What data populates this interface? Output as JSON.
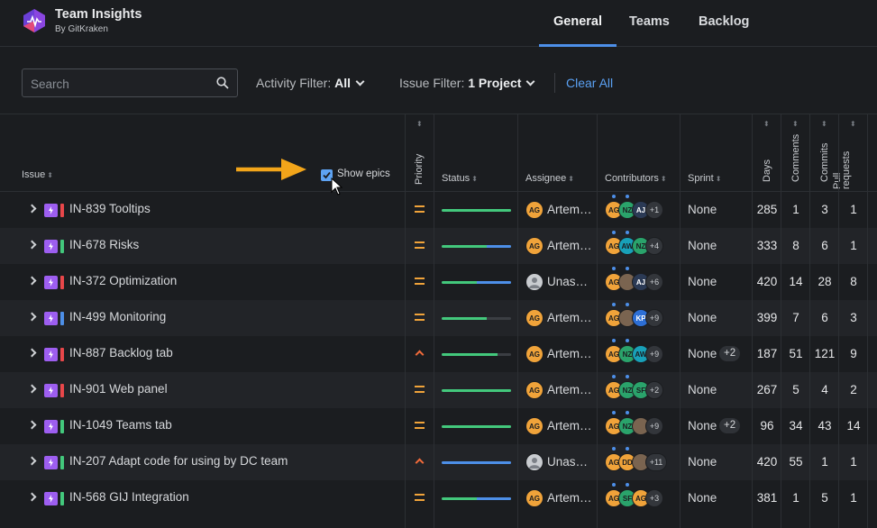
{
  "app": {
    "title": "Team Insights",
    "subtitle": "By GitKraken"
  },
  "nav": {
    "tabs": [
      "General",
      "Teams",
      "Backlog"
    ],
    "active": "General"
  },
  "filters": {
    "search_placeholder": "Search",
    "activity_label": "Activity Filter:",
    "activity_value": "All",
    "issue_label": "Issue Filter:",
    "issue_value": "1 Project",
    "clear_all": "Clear All"
  },
  "columns": {
    "issue": "Issue",
    "show_epics": "Show epics",
    "priority": "Priority",
    "status": "Status",
    "assignee": "Assignee",
    "contributors": "Contributors",
    "sprint": "Sprint",
    "days": "Days",
    "comments": "Comments",
    "commits": "Commits",
    "pull_requests": "Pull requests"
  },
  "colors": {
    "accent": "#4d8fe8",
    "epic": "#9d5ef0",
    "orange": "#f0a33a",
    "green": "#43c87c"
  },
  "rows": [
    {
      "issue": "IN-839 Tooltips",
      "bar_color": "#e8474a",
      "priority": "medium",
      "status_green": 1.0,
      "status_blue": 0.0,
      "assignee": "Artem…",
      "assignee_initials": "AG",
      "assignee_type": "orange",
      "contributors": [
        "AG",
        "NZ",
        "AJ"
      ],
      "contributors_more": "+1",
      "sprint": "None",
      "sprint_more": "",
      "days": "285",
      "comments": "1",
      "commits": "3",
      "prs": "1"
    },
    {
      "issue": "IN-678 Risks",
      "bar_color": "#43c87c",
      "priority": "medium",
      "status_green": 0.65,
      "status_blue": 0.35,
      "assignee": "Artem…",
      "assignee_initials": "AG",
      "assignee_type": "orange",
      "contributors": [
        "AG",
        "AW",
        "NZ"
      ],
      "contributors_more": "+4",
      "sprint": "None",
      "sprint_more": "",
      "days": "333",
      "comments": "8",
      "commits": "6",
      "prs": "1"
    },
    {
      "issue": "IN-372 Optimization",
      "bar_color": "#e8474a",
      "priority": "medium",
      "status_green": 0.5,
      "status_blue": 0.5,
      "assignee": "Unas…",
      "assignee_initials": "",
      "assignee_type": "grey",
      "contributors": [
        "AG",
        "PH",
        "AJ"
      ],
      "contributors_more": "+6",
      "sprint": "None",
      "sprint_more": "",
      "days": "420",
      "comments": "14",
      "commits": "28",
      "prs": "8"
    },
    {
      "issue": "IN-499 Monitoring",
      "bar_color": "#4d8fe8",
      "priority": "medium",
      "status_green": 0.65,
      "status_blue": 0.0,
      "assignee": "Artem…",
      "assignee_initials": "AG",
      "assignee_type": "orange",
      "contributors": [
        "AG",
        "PH",
        "KP"
      ],
      "contributors_more": "+9",
      "sprint": "None",
      "sprint_more": "",
      "days": "399",
      "comments": "7",
      "commits": "6",
      "prs": "3"
    },
    {
      "issue": "IN-887 Backlog tab",
      "bar_color": "#e8474a",
      "priority": "high",
      "status_green": 0.8,
      "status_blue": 0.0,
      "assignee": "Artem…",
      "assignee_initials": "AG",
      "assignee_type": "orange",
      "contributors": [
        "AG",
        "NZ",
        "AW"
      ],
      "contributors_more": "+9",
      "sprint": "None",
      "sprint_more": "+2",
      "days": "187",
      "comments": "51",
      "commits": "121",
      "prs": "9"
    },
    {
      "issue": "IN-901 Web panel",
      "bar_color": "#e8474a",
      "priority": "medium",
      "status_green": 1.0,
      "status_blue": 0.0,
      "assignee": "Artem…",
      "assignee_initials": "AG",
      "assignee_type": "orange",
      "contributors": [
        "AG",
        "NZ",
        "SF"
      ],
      "contributors_more": "+2",
      "sprint": "None",
      "sprint_more": "",
      "days": "267",
      "comments": "5",
      "commits": "4",
      "prs": "2"
    },
    {
      "issue": "IN-1049 Teams tab",
      "bar_color": "#43c87c",
      "priority": "medium",
      "status_green": 1.0,
      "status_blue": 0.0,
      "assignee": "Artem…",
      "assignee_initials": "AG",
      "assignee_type": "orange",
      "contributors": [
        "AG",
        "NZ",
        "PH"
      ],
      "contributors_more": "+9",
      "sprint": "None",
      "sprint_more": "+2",
      "days": "96",
      "comments": "34",
      "commits": "43",
      "prs": "14"
    },
    {
      "issue": "IN-207 Adapt code for using by DC team",
      "bar_color": "#43c87c",
      "priority": "high",
      "status_green": 0.0,
      "status_blue": 1.0,
      "assignee": "Unas…",
      "assignee_initials": "",
      "assignee_type": "grey",
      "contributors": [
        "AG",
        "DD",
        "PH"
      ],
      "contributors_more": "+11",
      "sprint": "None",
      "sprint_more": "",
      "days": "420",
      "comments": "55",
      "commits": "1",
      "prs": "1"
    },
    {
      "issue": "IN-568 GIJ Integration",
      "bar_color": "#43c87c",
      "priority": "medium",
      "status_green": 0.5,
      "status_blue": 0.5,
      "assignee": "Artem…",
      "assignee_initials": "AG",
      "assignee_type": "orange",
      "contributors": [
        "AG",
        "SF",
        "AG"
      ],
      "contributors_more": "+3",
      "sprint": "None",
      "sprint_more": "",
      "days": "381",
      "comments": "1",
      "commits": "5",
      "prs": "1"
    }
  ]
}
